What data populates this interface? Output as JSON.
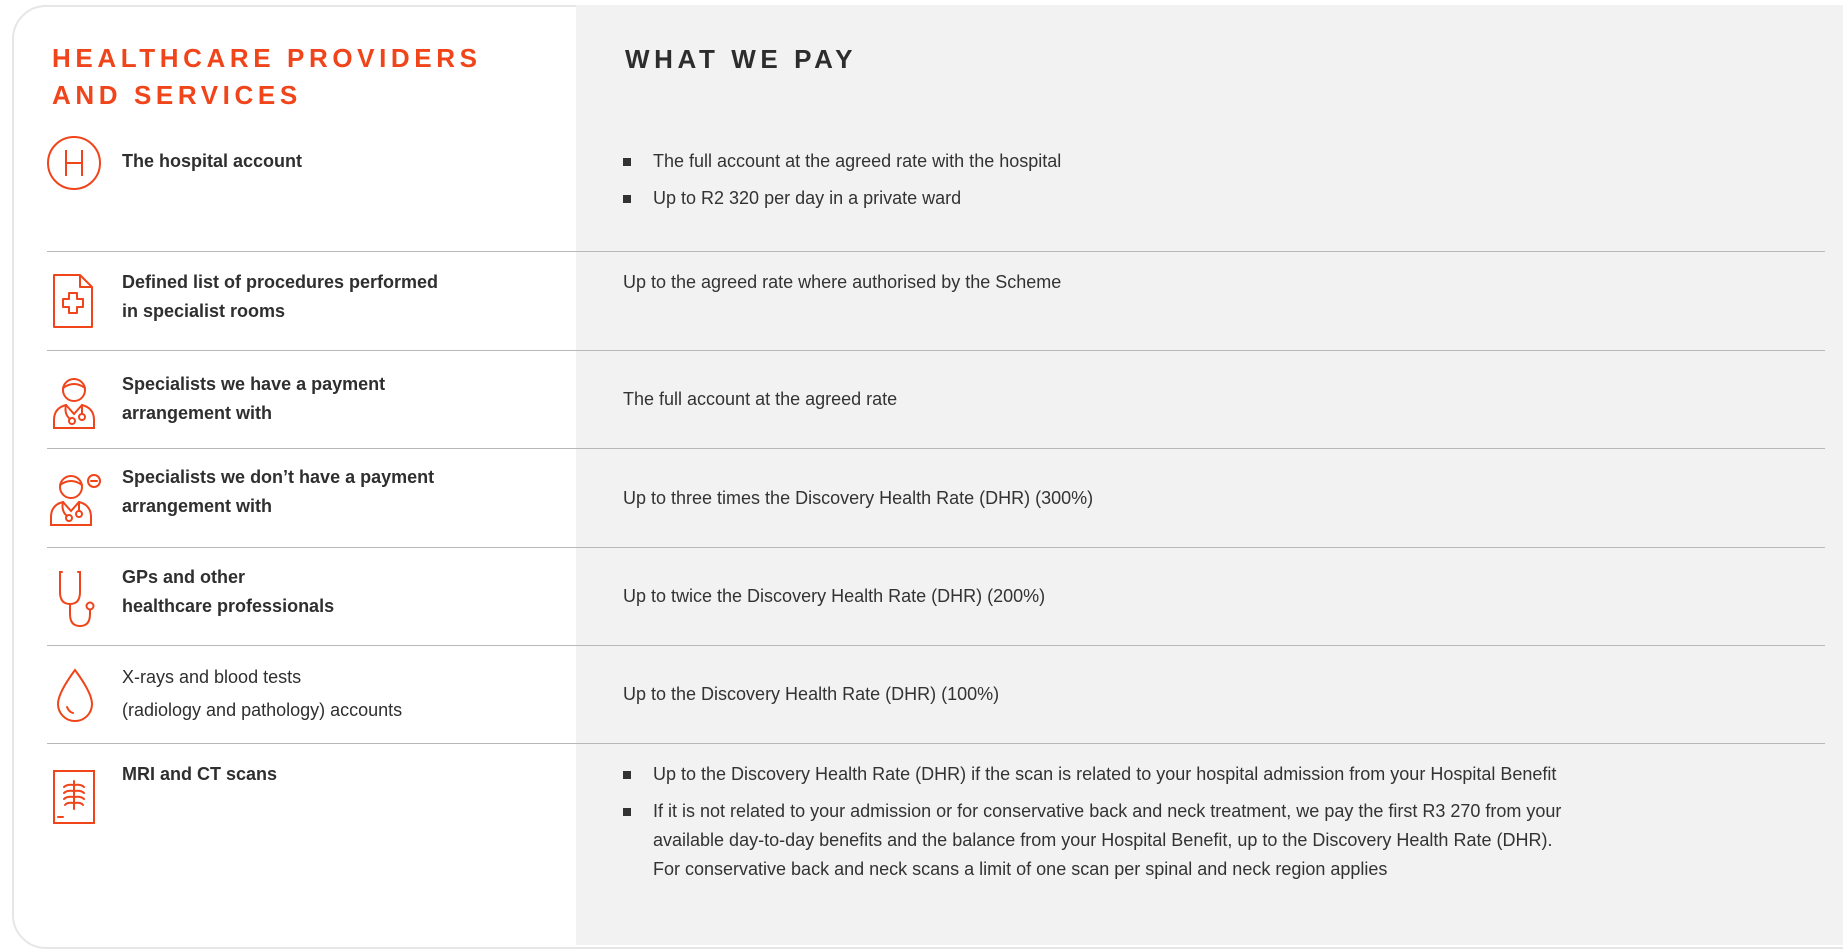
{
  "headers": {
    "left_line1": "HEALTHCARE PROVIDERS",
    "left_line2": "AND SERVICES",
    "right": "WHAT WE PAY"
  },
  "colors": {
    "accent": "#f0441a",
    "right_bg": "#f2f2f2",
    "divider": "#b8b8b8"
  },
  "rows": [
    {
      "icon": "hospital-h-icon",
      "label_lines": [
        "The hospital account"
      ],
      "bullets": [
        "The full account at the agreed rate with the hospital",
        "Up to R2 320 per day in a private ward"
      ]
    },
    {
      "icon": "medical-document-cross-icon",
      "label_lines": [
        "Defined list of procedures performed",
        "in specialist rooms"
      ],
      "value": "Up to the agreed rate where authorised by the Scheme"
    },
    {
      "icon": "specialist-doctor-icon",
      "label_lines": [
        "Specialists we have a payment",
        "arrangement with"
      ],
      "value": "The full account at the agreed rate"
    },
    {
      "icon": "specialist-doctor-minus-icon",
      "label_lines": [
        "Specialists we don’t have a payment",
        "arrangement with"
      ],
      "value": "Up to three times the Discovery Health Rate (DHR) (300%)"
    },
    {
      "icon": "stethoscope-icon",
      "label_lines": [
        "GPs and other",
        "healthcare professionals"
      ],
      "value": "Up to twice the Discovery Health Rate (DHR) (200%)"
    },
    {
      "icon": "blood-drop-icon",
      "label_lines": [
        "X-rays and blood tests",
        "(radiology and pathology) accounts"
      ],
      "value": "Up to the Discovery Health Rate (DHR) (100%)"
    },
    {
      "icon": "xray-scan-icon",
      "label_lines": [
        "MRI and CT scans"
      ],
      "bullets": [
        "Up to the Discovery Health Rate (DHR) if the scan is related to your hospital admission from your Hospital Benefit",
        "If it is not related to your admission or for conservative back and neck treatment, we pay the first R3 270 from your",
        "available day-to-day benefits and the balance from your Hospital Benefit, up to the Discovery Health Rate (DHR).",
        "For conservative back and neck scans a limit of one scan per spinal and neck region applies"
      ]
    }
  ]
}
